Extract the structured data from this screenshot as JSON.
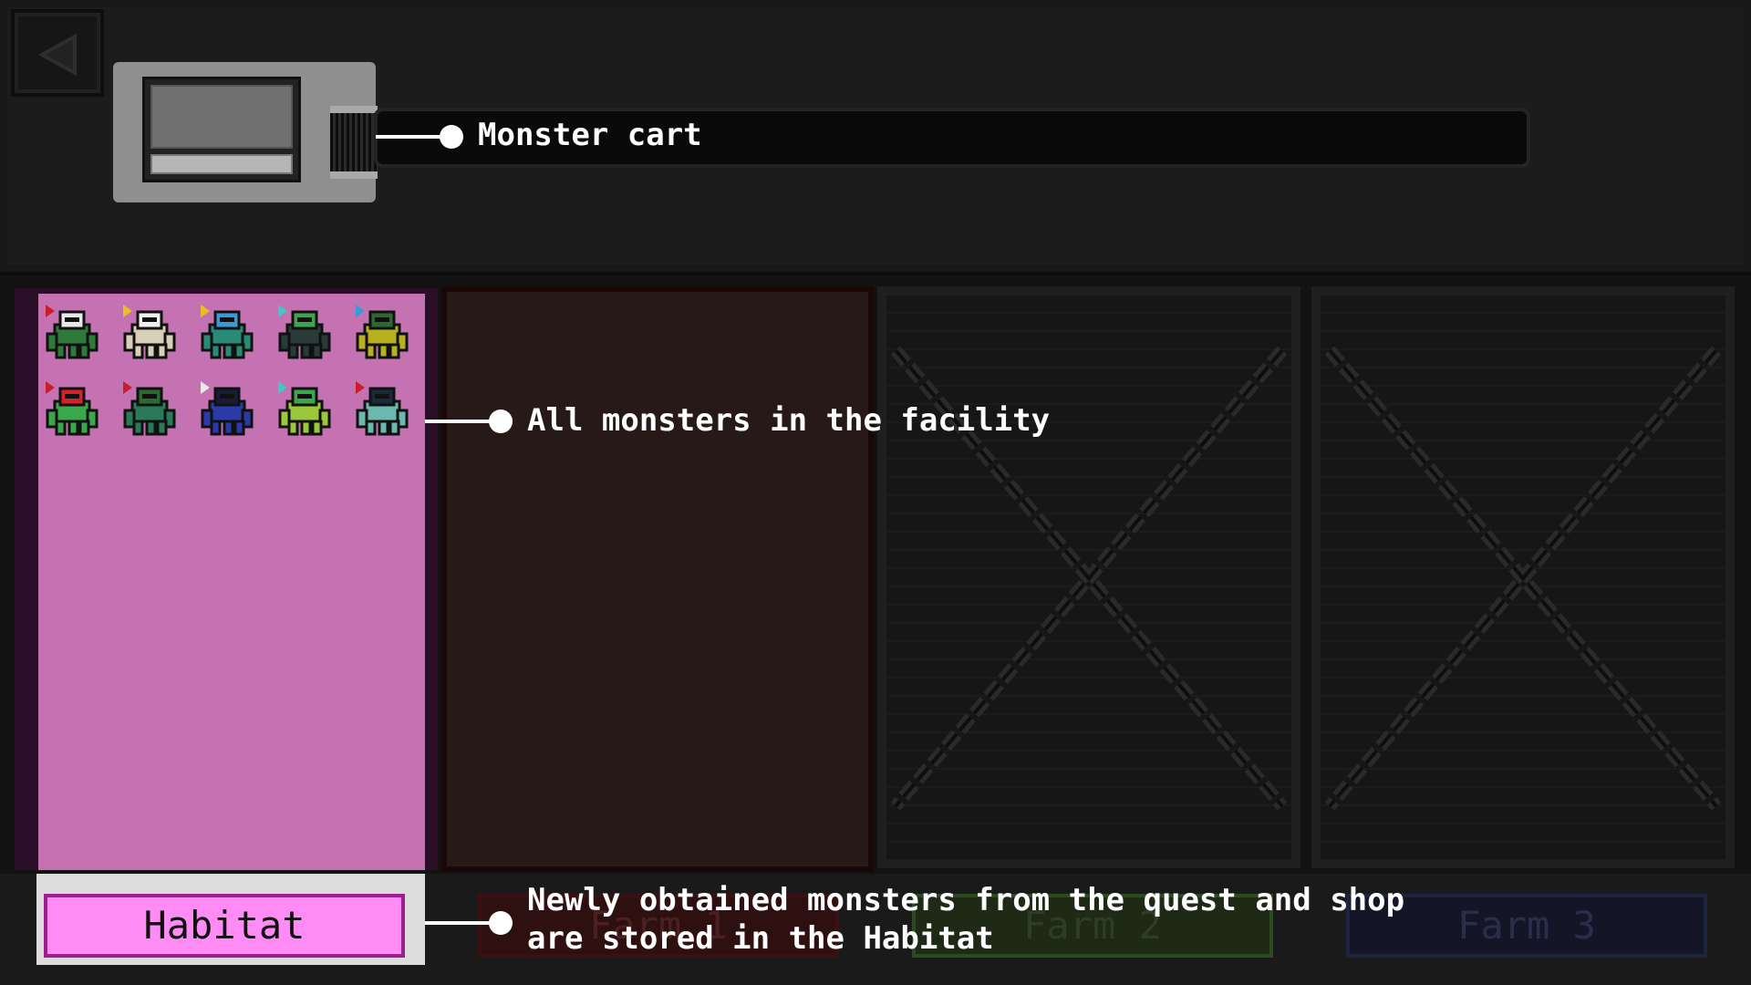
{
  "top": {
    "back_icon": "back-arrow-icon",
    "cart_label": "Monster cart"
  },
  "callouts": {
    "all_monsters": "All monsters in the facility",
    "habitat_line1": "Newly obtained monsters from the quest and shop",
    "habitat_line2": "are stored in the Habitat"
  },
  "tabs": [
    {
      "label": "Habitat",
      "state": "selected"
    },
    {
      "label": "Farm 1",
      "state": "available"
    },
    {
      "label": "Farm 2",
      "state": "locked"
    },
    {
      "label": "Farm 3",
      "state": "locked"
    }
  ],
  "monsters": [
    {
      "name": "monster-1",
      "body": "#2f7a3a",
      "head": "#e8e8e8",
      "flag": "#c81e2a"
    },
    {
      "name": "monster-2",
      "body": "#d8d0b8",
      "head": "#f0f0f0",
      "flag": "#e8c020"
    },
    {
      "name": "monster-3",
      "body": "#2a8a78",
      "head": "#3a9ad8",
      "flag": "#e8c020"
    },
    {
      "name": "monster-4",
      "body": "#2a3a38",
      "head": "#3aa84a",
      "flag": "#3ac8c8"
    },
    {
      "name": "monster-5",
      "body": "#b8b020",
      "head": "#2a6a30",
      "flag": "#3a9ad8"
    },
    {
      "name": "monster-6",
      "body": "#3aa84a",
      "head": "#d8202a",
      "flag": "#c81e2a"
    },
    {
      "name": "monster-7",
      "body": "#2a7a5a",
      "head": "#2a6a30",
      "flag": "#c81e2a"
    },
    {
      "name": "monster-8",
      "body": "#2a3aa8",
      "head": "#1a1a3a",
      "flag": "#e8e8e8"
    },
    {
      "name": "monster-9",
      "body": "#9ac83a",
      "head": "#3aa84a",
      "flag": "#3ac8c8"
    },
    {
      "name": "monster-10",
      "body": "#6ab8b0",
      "head": "#1a2a3a",
      "flag": "#c81e2a"
    }
  ],
  "colors": {
    "habitat_panel": "#c472b1",
    "habitat_tab": "#ff8cf5",
    "farm1_panel": "#261918",
    "locked_panel": "#161616"
  }
}
